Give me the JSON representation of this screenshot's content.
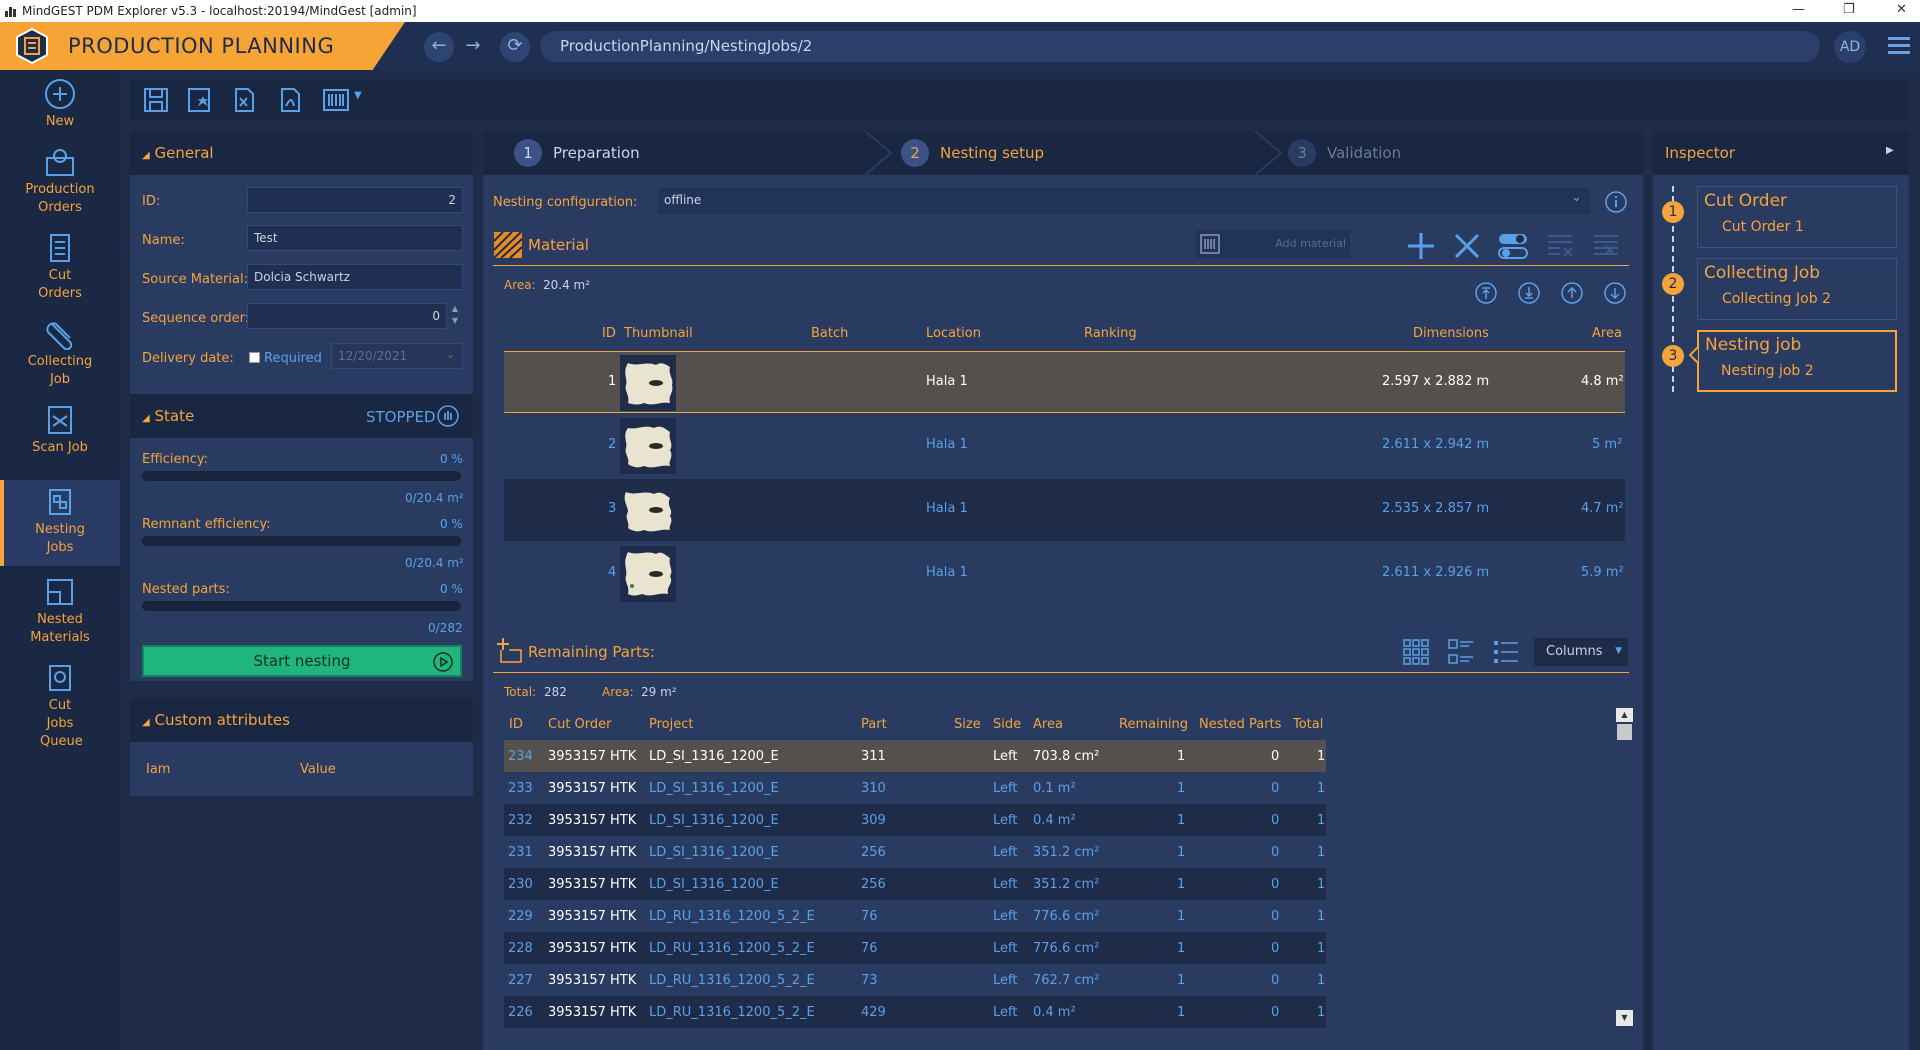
{
  "window": {
    "title": "MindGEST PDM Explorer v5.3 - localhost:20194/MindGest [admin]"
  },
  "header": {
    "app_title": "PRODUCTION PLANNING",
    "url": "ProductionPlanning/NestingJobs/2",
    "avatar": "AD"
  },
  "sidebar": {
    "items": [
      {
        "label": "New",
        "icon": "plus-circle-icon"
      },
      {
        "label": "Production Orders",
        "icon": "gear-icon"
      },
      {
        "label": "Cut Orders",
        "icon": "document-icon"
      },
      {
        "label": "Collecting Job",
        "icon": "clip-icon"
      },
      {
        "label": "Scan Job",
        "icon": "scan-icon"
      },
      {
        "label": "Nesting Jobs",
        "icon": "nesting-icon"
      },
      {
        "label": "Nested Materials",
        "icon": "layers-icon"
      },
      {
        "label": "Cut Jobs Queue",
        "icon": "queue-icon"
      }
    ],
    "active_index": 5
  },
  "general": {
    "title": "General",
    "id_label": "ID:",
    "id_value": "2",
    "name_label": "Name:",
    "name_value": "Test",
    "source_label": "Source Material:",
    "source_value": "Dolcia Schwartz",
    "sequence_label": "Sequence order:",
    "sequence_value": "0",
    "delivery_label": "Delivery date:",
    "required_label": "Required",
    "delivery_value": "12/20/2021"
  },
  "state": {
    "title": "State",
    "status": "STOPPED",
    "efficiency_label": "Efficiency:",
    "efficiency_pct": "0 %",
    "efficiency_area": "0/20.4 m²",
    "remnant_label": "Remnant efficiency:",
    "remnant_pct": "0 %",
    "remnant_area": "0/20.4 m²",
    "nested_label": "Nested parts:",
    "nested_pct": "0 %",
    "nested_count": "0/282",
    "start_button": "Start nesting"
  },
  "custom_attributes": {
    "title": "Custom attributes",
    "col_name": "Iam",
    "col_value": "Value"
  },
  "steps": [
    {
      "num": "1",
      "label": "Preparation"
    },
    {
      "num": "2",
      "label": "Nesting setup"
    },
    {
      "num": "3",
      "label": "Validation"
    }
  ],
  "nesting_config": {
    "label": "Nesting configuration:",
    "value": "offline"
  },
  "material": {
    "title": "Material",
    "add_placeholder": "Add material",
    "area_label": "Area:",
    "area_value": "20.4 m²",
    "columns": [
      "ID",
      "Thumbnail",
      "Batch",
      "Location",
      "Ranking",
      "Dimensions",
      "Area"
    ],
    "rows": [
      {
        "id": "1",
        "location": "Hala 1",
        "dimensions": "2.597 x 2.882 m",
        "area": "4.8 m²"
      },
      {
        "id": "2",
        "location": "Hala 1",
        "dimensions": "2.611 x 2.942 m",
        "area": "5 m²"
      },
      {
        "id": "3",
        "location": "Hala 1",
        "dimensions": "2.535 x 2.857 m",
        "area": "4.7 m²"
      },
      {
        "id": "4",
        "location": "Hala 1",
        "dimensions": "2.611 x 2.926 m",
        "area": "5.9 m²"
      }
    ]
  },
  "remaining": {
    "title": "Remaining Parts:",
    "total_label": "Total:",
    "total_value": "282",
    "area_label": "Area:",
    "area_value": "29 m²",
    "columns_button": "Columns",
    "columns": [
      "ID",
      "Cut Order",
      "Project",
      "Part",
      "Size",
      "Side",
      "Area",
      "Remaining",
      "Nested Parts",
      "Total"
    ],
    "rows": [
      {
        "id": "234",
        "cut_order": "3953157 HTK",
        "project": "LD_SI_1316_1200_E",
        "part": "311",
        "size": "",
        "side": "Left",
        "area": "703.8 cm²",
        "remaining": "1",
        "nested": "0",
        "total": "1"
      },
      {
        "id": "233",
        "cut_order": "3953157 HTK",
        "project": "LD_SI_1316_1200_E",
        "part": "310",
        "size": "",
        "side": "Left",
        "area": "0.1 m²",
        "remaining": "1",
        "nested": "0",
        "total": "1"
      },
      {
        "id": "232",
        "cut_order": "3953157 HTK",
        "project": "LD_SI_1316_1200_E",
        "part": "309",
        "size": "",
        "side": "Left",
        "area": "0.4 m²",
        "remaining": "1",
        "nested": "0",
        "total": "1"
      },
      {
        "id": "231",
        "cut_order": "3953157 HTK",
        "project": "LD_SI_1316_1200_E",
        "part": "256",
        "size": "",
        "side": "Left",
        "area": "351.2 cm²",
        "remaining": "1",
        "nested": "0",
        "total": "1"
      },
      {
        "id": "230",
        "cut_order": "3953157 HTK",
        "project": "LD_SI_1316_1200_E",
        "part": "256",
        "size": "",
        "side": "Left",
        "area": "351.2 cm²",
        "remaining": "1",
        "nested": "0",
        "total": "1"
      },
      {
        "id": "229",
        "cut_order": "3953157 HTK",
        "project": "LD_RU_1316_1200_5_2_E",
        "part": "76",
        "size": "",
        "side": "Left",
        "area": "776.6 cm²",
        "remaining": "1",
        "nested": "0",
        "total": "1"
      },
      {
        "id": "228",
        "cut_order": "3953157 HTK",
        "project": "LD_RU_1316_1200_5_2_E",
        "part": "76",
        "size": "",
        "side": "Left",
        "area": "776.6 cm²",
        "remaining": "1",
        "nested": "0",
        "total": "1"
      },
      {
        "id": "227",
        "cut_order": "3953157 HTK",
        "project": "LD_RU_1316_1200_5_2_E",
        "part": "73",
        "size": "",
        "side": "Left",
        "area": "762.7 cm²",
        "remaining": "1",
        "nested": "0",
        "total": "1"
      },
      {
        "id": "226",
        "cut_order": "3953157 HTK",
        "project": "LD_RU_1316_1200_5_2_E",
        "part": "429",
        "size": "",
        "side": "Left",
        "area": "0.4 m²",
        "remaining": "1",
        "nested": "0",
        "total": "1"
      }
    ]
  },
  "inspector": {
    "title": "Inspector",
    "items": [
      {
        "num": "1",
        "title": "Cut Order",
        "sub": "Cut Order 1"
      },
      {
        "num": "2",
        "title": "Collecting Job",
        "sub": "Collecting Job 2"
      },
      {
        "num": "3",
        "title": "Nesting job",
        "sub": "Nesting job 2"
      }
    ],
    "active_index": 2
  },
  "colors": {
    "accent": "#f5a33a",
    "background": "#1e2c4a",
    "panel": "#2a3b62",
    "link": "#5aa0e6",
    "start_button": "#21b57e"
  }
}
